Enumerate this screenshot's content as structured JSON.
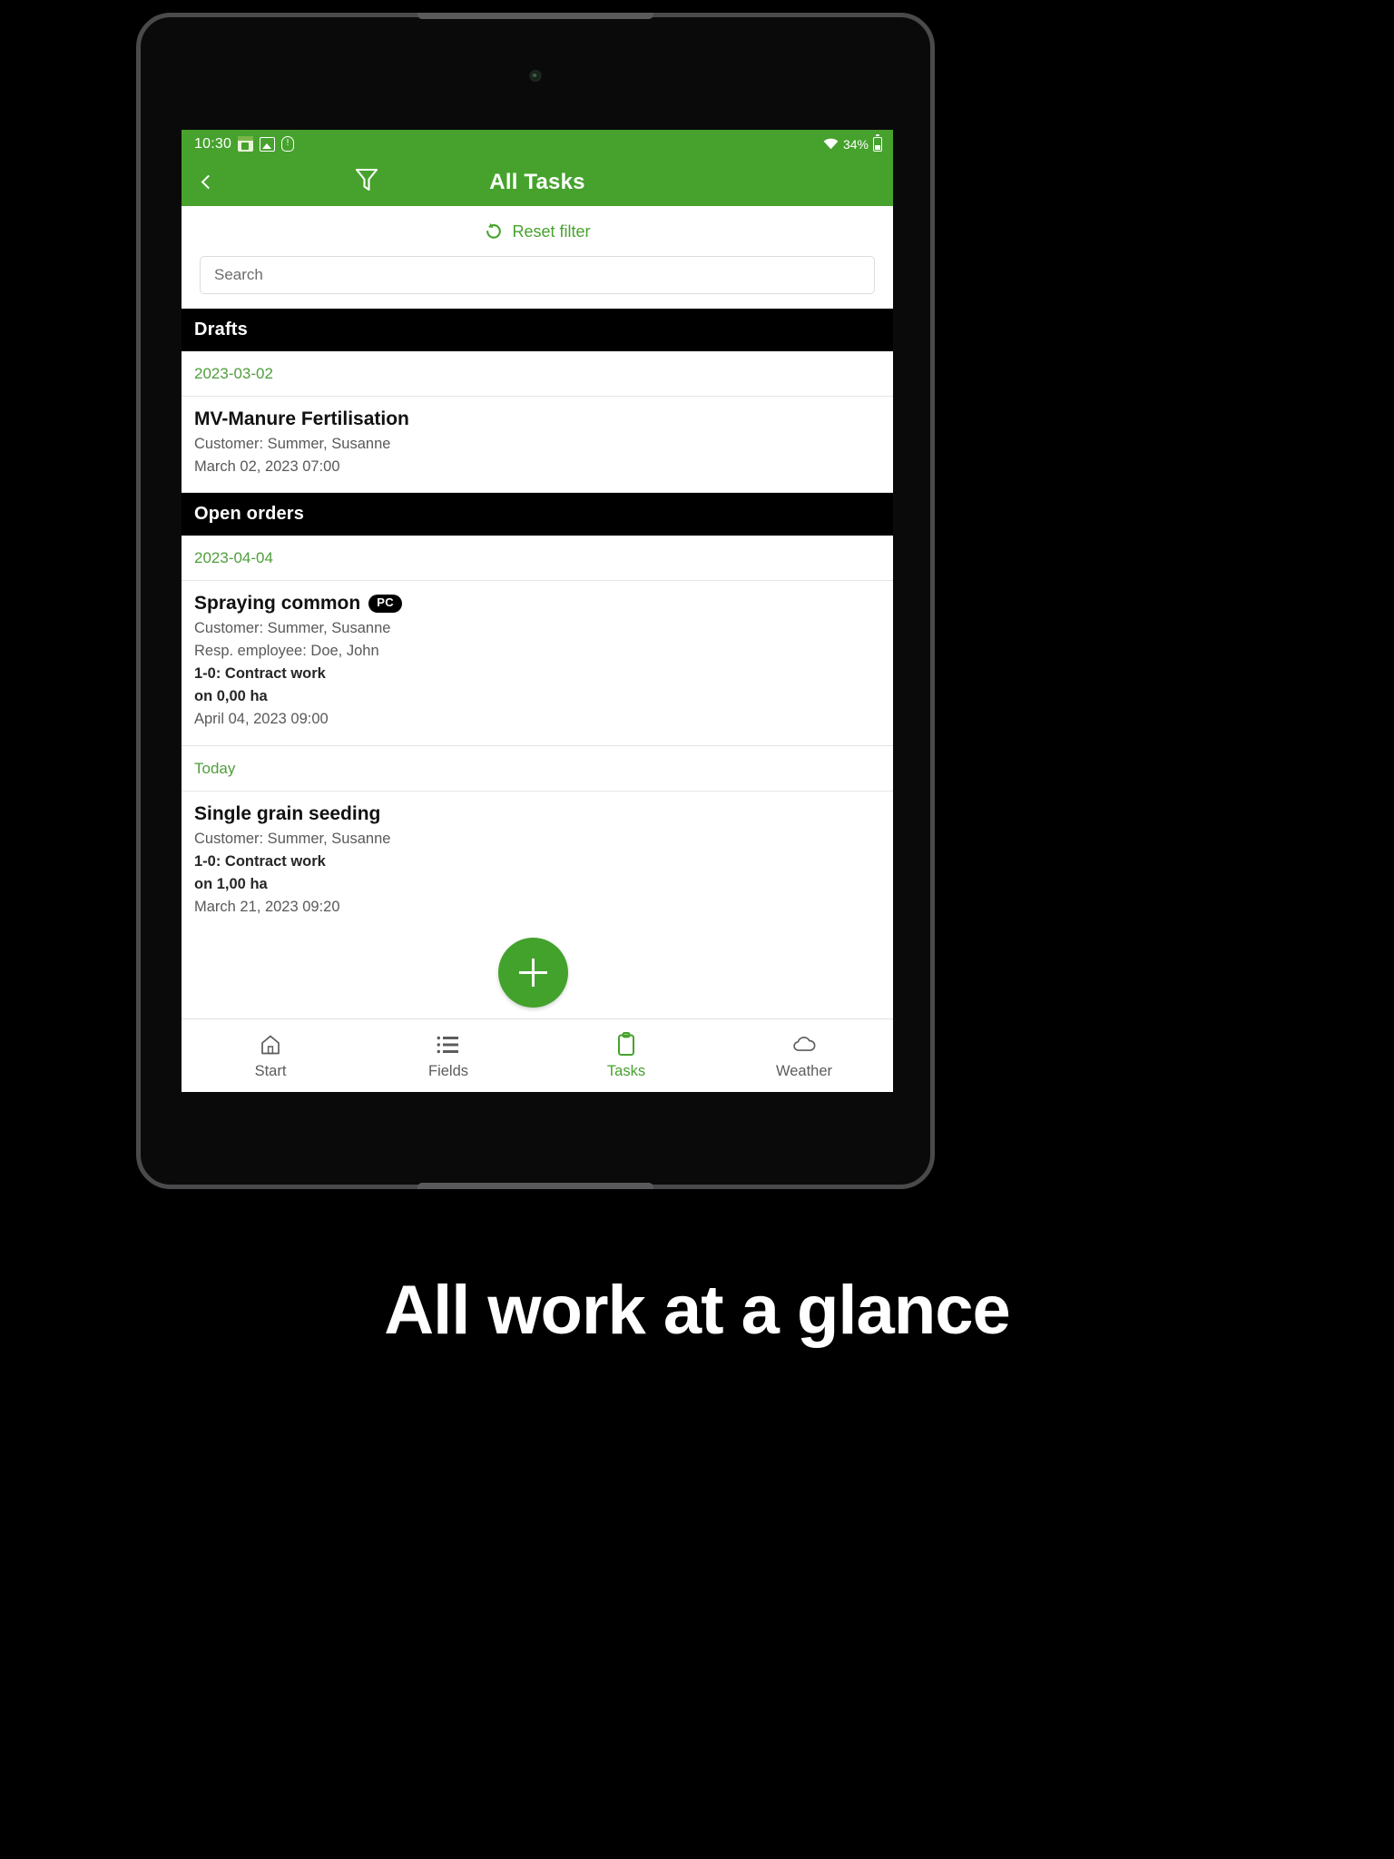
{
  "status_bar": {
    "time": "10:30",
    "icons": [
      "app-icon",
      "photo-icon",
      "shield-icon"
    ],
    "wifi_icon": "wifi-icon",
    "battery_text": "34%",
    "battery_icon": "battery-icon"
  },
  "app_bar": {
    "back_icon": "chevron-left-icon",
    "filter_icon": "filter-funnel-icon",
    "title": "All Tasks"
  },
  "filter_panel": {
    "reset_label": "Reset filter",
    "reset_icon": "reset-rotate-icon",
    "search_placeholder": "Search",
    "search_value": ""
  },
  "sections": [
    {
      "header": "Drafts",
      "groups": [
        {
          "date": "2023-03-02",
          "tasks": [
            {
              "title": "MV-Manure Fertilisation",
              "badge": "",
              "lines": [
                {
                  "text": "Customer: Summer, Susanne",
                  "bold": false
                },
                {
                  "text": "March 02, 2023 07:00",
                  "bold": false
                }
              ]
            }
          ]
        }
      ]
    },
    {
      "header": "Open orders",
      "groups": [
        {
          "date": "2023-04-04",
          "tasks": [
            {
              "title": "Spraying common",
              "badge": "PC",
              "lines": [
                {
                  "text": "Customer: Summer, Susanne",
                  "bold": false
                },
                {
                  "text": "Resp. employee: Doe, John",
                  "bold": false
                },
                {
                  "text": "1-0: Contract work",
                  "bold": true
                },
                {
                  "text": "on 0,00 ha",
                  "bold": true
                },
                {
                  "text": "April 04, 2023 09:00",
                  "bold": false
                }
              ]
            }
          ]
        },
        {
          "date": "Today",
          "tasks": [
            {
              "title": "Single grain seeding",
              "badge": "",
              "lines": [
                {
                  "text": "Customer: Summer, Susanne",
                  "bold": false
                },
                {
                  "text": "1-0: Contract work",
                  "bold": true
                },
                {
                  "text": "on 1,00 ha",
                  "bold": true
                },
                {
                  "text": "March 21, 2023 09:20",
                  "bold": false
                }
              ]
            }
          ]
        }
      ]
    }
  ],
  "fab": {
    "icon": "plus-icon",
    "label": ""
  },
  "bottom_nav": {
    "items": [
      {
        "label": "Start",
        "icon": "home-icon",
        "active": false
      },
      {
        "label": "Fields",
        "icon": "list-icon",
        "active": false
      },
      {
        "label": "Tasks",
        "icon": "clipboard-icon",
        "active": true
      },
      {
        "label": "Weather",
        "icon": "cloud-icon",
        "active": false
      }
    ]
  },
  "caption": "All work at a glance",
  "colors": {
    "brand_green": "#46A22D",
    "section_black": "#000000",
    "date_green": "#4f9e3b",
    "fab_green": "#43A22B"
  }
}
